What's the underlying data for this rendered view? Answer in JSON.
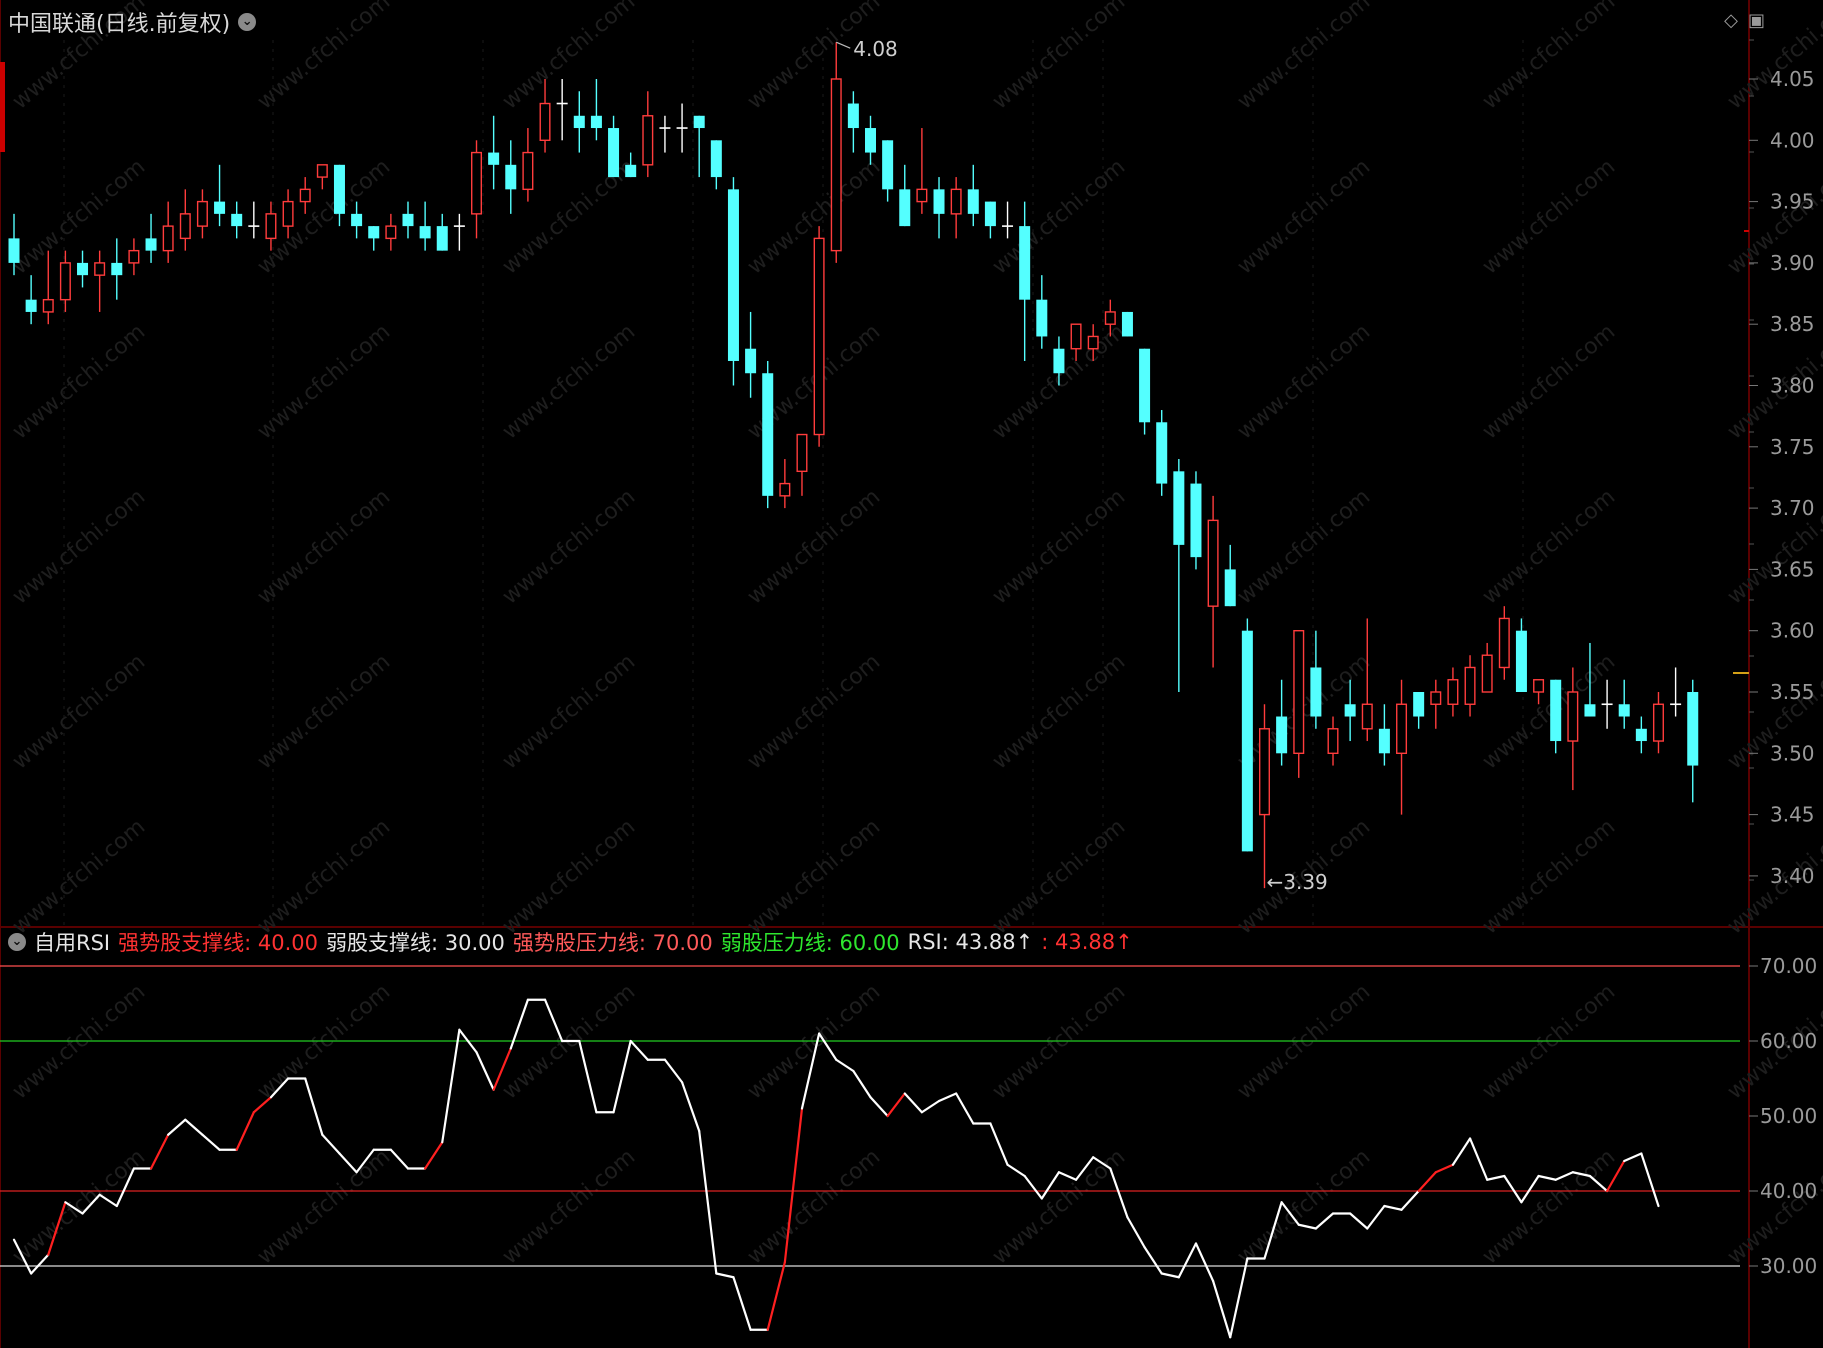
{
  "header": {
    "title": "中国联通(日线.前复权)",
    "menu_icon": "chevron-down-icon",
    "window_icons": [
      "diamond-icon",
      "restore-icon"
    ]
  },
  "price_panel": {
    "y_axis_labels": [
      "4.05",
      "4.00",
      "3.95",
      "3.90",
      "3.85",
      "3.80",
      "3.75",
      "3.70",
      "3.65",
      "3.60",
      "3.55",
      "3.50",
      "3.45",
      "3.40"
    ],
    "high_annotation": "4.08",
    "low_annotation": "3.39",
    "colors": {
      "up": "#ff3c3c",
      "down": "#54ffff",
      "doji": "#ffffff"
    }
  },
  "rsi_panel": {
    "indicator_name": "自用RSI",
    "legend": [
      {
        "text": "强势股支撑线: 40.00",
        "color": "#ff3232"
      },
      {
        "text": "弱股支撑线: 30.00",
        "color": "#e6e6e6"
      },
      {
        "text": "强势股压力线: 70.00",
        "color": "#ff5a5a"
      },
      {
        "text": "弱股压力线: 60.00",
        "color": "#2ee62e"
      },
      {
        "text": "RSI: 43.88↑",
        "color": "#e6e6e6"
      },
      {
        "text": ": 43.88↑",
        "color": "#ff3232"
      }
    ],
    "y_axis_labels": [
      "70.00",
      "60.00",
      "50.00",
      "40.00",
      "30.00"
    ],
    "level_colors": {
      "70": "#ff5050",
      "60": "#22cc22",
      "40": "#dd2222",
      "30": "#dddddd"
    }
  },
  "watermark": "www.cfchi.com",
  "chart_data": [
    {
      "type": "candlestick",
      "title": "中国联通(日线.前复权)",
      "ylim": [
        3.37,
        4.1
      ],
      "candles": [
        {
          "o": 3.92,
          "h": 3.94,
          "l": 3.89,
          "c": 3.9
        },
        {
          "o": 3.87,
          "h": 3.89,
          "l": 3.85,
          "c": 3.86
        },
        {
          "o": 3.86,
          "h": 3.91,
          "l": 3.85,
          "c": 3.87
        },
        {
          "o": 3.87,
          "h": 3.91,
          "l": 3.86,
          "c": 3.9
        },
        {
          "o": 3.9,
          "h": 3.91,
          "l": 3.88,
          "c": 3.89
        },
        {
          "o": 3.89,
          "h": 3.91,
          "l": 3.86,
          "c": 3.9
        },
        {
          "o": 3.9,
          "h": 3.92,
          "l": 3.87,
          "c": 3.89
        },
        {
          "o": 3.9,
          "h": 3.92,
          "l": 3.89,
          "c": 3.91
        },
        {
          "o": 3.92,
          "h": 3.94,
          "l": 3.9,
          "c": 3.91
        },
        {
          "o": 3.91,
          "h": 3.95,
          "l": 3.9,
          "c": 3.93
        },
        {
          "o": 3.92,
          "h": 3.96,
          "l": 3.91,
          "c": 3.94
        },
        {
          "o": 3.93,
          "h": 3.96,
          "l": 3.92,
          "c": 3.95
        },
        {
          "o": 3.95,
          "h": 3.98,
          "l": 3.93,
          "c": 3.94
        },
        {
          "o": 3.94,
          "h": 3.95,
          "l": 3.92,
          "c": 3.93
        },
        {
          "o": 3.93,
          "h": 3.95,
          "l": 3.92,
          "c": 3.93
        },
        {
          "o": 3.92,
          "h": 3.95,
          "l": 3.91,
          "c": 3.94
        },
        {
          "o": 3.93,
          "h": 3.96,
          "l": 3.92,
          "c": 3.95
        },
        {
          "o": 3.95,
          "h": 3.97,
          "l": 3.94,
          "c": 3.96
        },
        {
          "o": 3.97,
          "h": 3.98,
          "l": 3.96,
          "c": 3.98
        },
        {
          "o": 3.98,
          "h": 3.98,
          "l": 3.93,
          "c": 3.94
        },
        {
          "o": 3.94,
          "h": 3.95,
          "l": 3.92,
          "c": 3.93
        },
        {
          "o": 3.93,
          "h": 3.93,
          "l": 3.91,
          "c": 3.92
        },
        {
          "o": 3.92,
          "h": 3.94,
          "l": 3.91,
          "c": 3.93
        },
        {
          "o": 3.94,
          "h": 3.95,
          "l": 3.92,
          "c": 3.93
        },
        {
          "o": 3.93,
          "h": 3.95,
          "l": 3.91,
          "c": 3.92
        },
        {
          "o": 3.93,
          "h": 3.94,
          "l": 3.91,
          "c": 3.91
        },
        {
          "o": 3.93,
          "h": 3.94,
          "l": 3.91,
          "c": 3.93
        },
        {
          "o": 3.94,
          "h": 4.0,
          "l": 3.92,
          "c": 3.99
        },
        {
          "o": 3.99,
          "h": 4.02,
          "l": 3.96,
          "c": 3.98
        },
        {
          "o": 3.98,
          "h": 4.0,
          "l": 3.94,
          "c": 3.96
        },
        {
          "o": 3.96,
          "h": 4.01,
          "l": 3.95,
          "c": 3.99
        },
        {
          "o": 4.0,
          "h": 4.05,
          "l": 3.99,
          "c": 4.03
        },
        {
          "o": 4.03,
          "h": 4.05,
          "l": 4.0,
          "c": 4.03
        },
        {
          "o": 4.02,
          "h": 4.04,
          "l": 3.99,
          "c": 4.01
        },
        {
          "o": 4.02,
          "h": 4.05,
          "l": 4.0,
          "c": 4.01
        },
        {
          "o": 4.01,
          "h": 4.02,
          "l": 3.97,
          "c": 3.97
        },
        {
          "o": 3.98,
          "h": 3.99,
          "l": 3.97,
          "c": 3.97
        },
        {
          "o": 3.98,
          "h": 4.04,
          "l": 3.97,
          "c": 4.02
        },
        {
          "o": 4.01,
          "h": 4.02,
          "l": 3.99,
          "c": 4.01
        },
        {
          "o": 4.01,
          "h": 4.03,
          "l": 3.99,
          "c": 4.01
        },
        {
          "o": 4.02,
          "h": 4.02,
          "l": 3.97,
          "c": 4.01
        },
        {
          "o": 4.0,
          "h": 4.0,
          "l": 3.96,
          "c": 3.97
        },
        {
          "o": 3.96,
          "h": 3.97,
          "l": 3.8,
          "c": 3.82
        },
        {
          "o": 3.83,
          "h": 3.86,
          "l": 3.79,
          "c": 3.81
        },
        {
          "o": 3.81,
          "h": 3.82,
          "l": 3.7,
          "c": 3.71
        },
        {
          "o": 3.71,
          "h": 3.74,
          "l": 3.7,
          "c": 3.72
        },
        {
          "o": 3.73,
          "h": 3.76,
          "l": 3.71,
          "c": 3.76
        },
        {
          "o": 3.76,
          "h": 3.93,
          "l": 3.75,
          "c": 3.92
        },
        {
          "o": 3.91,
          "h": 4.08,
          "l": 3.9,
          "c": 4.05
        },
        {
          "o": 4.03,
          "h": 4.04,
          "l": 3.99,
          "c": 4.01
        },
        {
          "o": 4.01,
          "h": 4.02,
          "l": 3.98,
          "c": 3.99
        },
        {
          "o": 4.0,
          "h": 4.0,
          "l": 3.95,
          "c": 3.96
        },
        {
          "o": 3.96,
          "h": 3.98,
          "l": 3.93,
          "c": 3.93
        },
        {
          "o": 3.95,
          "h": 4.01,
          "l": 3.94,
          "c": 3.96
        },
        {
          "o": 3.96,
          "h": 3.97,
          "l": 3.92,
          "c": 3.94
        },
        {
          "o": 3.94,
          "h": 3.97,
          "l": 3.92,
          "c": 3.96
        },
        {
          "o": 3.96,
          "h": 3.98,
          "l": 3.93,
          "c": 3.94
        },
        {
          "o": 3.95,
          "h": 3.95,
          "l": 3.92,
          "c": 3.93
        },
        {
          "o": 3.93,
          "h": 3.95,
          "l": 3.92,
          "c": 3.93
        },
        {
          "o": 3.93,
          "h": 3.95,
          "l": 3.82,
          "c": 3.87
        },
        {
          "o": 3.87,
          "h": 3.89,
          "l": 3.83,
          "c": 3.84
        },
        {
          "o": 3.83,
          "h": 3.84,
          "l": 3.8,
          "c": 3.81
        },
        {
          "o": 3.83,
          "h": 3.85,
          "l": 3.82,
          "c": 3.85
        },
        {
          "o": 3.83,
          "h": 3.85,
          "l": 3.82,
          "c": 3.84
        },
        {
          "o": 3.85,
          "h": 3.87,
          "l": 3.84,
          "c": 3.86
        },
        {
          "o": 3.86,
          "h": 3.86,
          "l": 3.84,
          "c": 3.84
        },
        {
          "o": 3.83,
          "h": 3.83,
          "l": 3.76,
          "c": 3.77
        },
        {
          "o": 3.77,
          "h": 3.78,
          "l": 3.71,
          "c": 3.72
        },
        {
          "o": 3.73,
          "h": 3.74,
          "l": 3.55,
          "c": 3.67
        },
        {
          "o": 3.72,
          "h": 3.73,
          "l": 3.65,
          "c": 3.66
        },
        {
          "o": 3.62,
          "h": 3.71,
          "l": 3.57,
          "c": 3.69
        },
        {
          "o": 3.65,
          "h": 3.67,
          "l": 3.62,
          "c": 3.62
        },
        {
          "o": 3.6,
          "h": 3.61,
          "l": 3.42,
          "c": 3.42
        },
        {
          "o": 3.45,
          "h": 3.54,
          "l": 3.39,
          "c": 3.52
        },
        {
          "o": 3.53,
          "h": 3.56,
          "l": 3.49,
          "c": 3.5
        },
        {
          "o": 3.5,
          "h": 3.6,
          "l": 3.48,
          "c": 3.6
        },
        {
          "o": 3.57,
          "h": 3.6,
          "l": 3.52,
          "c": 3.53
        },
        {
          "o": 3.5,
          "h": 3.53,
          "l": 3.49,
          "c": 3.52
        },
        {
          "o": 3.54,
          "h": 3.56,
          "l": 3.51,
          "c": 3.53
        },
        {
          "o": 3.52,
          "h": 3.61,
          "l": 3.51,
          "c": 3.54
        },
        {
          "o": 3.52,
          "h": 3.54,
          "l": 3.49,
          "c": 3.5
        },
        {
          "o": 3.5,
          "h": 3.56,
          "l": 3.45,
          "c": 3.54
        },
        {
          "o": 3.55,
          "h": 3.55,
          "l": 3.52,
          "c": 3.53
        },
        {
          "o": 3.54,
          "h": 3.56,
          "l": 3.52,
          "c": 3.55
        },
        {
          "o": 3.54,
          "h": 3.57,
          "l": 3.53,
          "c": 3.56
        },
        {
          "o": 3.54,
          "h": 3.58,
          "l": 3.53,
          "c": 3.57
        },
        {
          "o": 3.55,
          "h": 3.59,
          "l": 3.55,
          "c": 3.58
        },
        {
          "o": 3.57,
          "h": 3.62,
          "l": 3.56,
          "c": 3.61
        },
        {
          "o": 3.6,
          "h": 3.61,
          "l": 3.55,
          "c": 3.55
        },
        {
          "o": 3.55,
          "h": 3.56,
          "l": 3.54,
          "c": 3.56
        },
        {
          "o": 3.56,
          "h": 3.56,
          "l": 3.5,
          "c": 3.51
        },
        {
          "o": 3.51,
          "h": 3.57,
          "l": 3.47,
          "c": 3.55
        },
        {
          "o": 3.54,
          "h": 3.59,
          "l": 3.53,
          "c": 3.53
        },
        {
          "o": 3.54,
          "h": 3.56,
          "l": 3.52,
          "c": 3.54
        },
        {
          "o": 3.54,
          "h": 3.56,
          "l": 3.52,
          "c": 3.53
        },
        {
          "o": 3.52,
          "h": 3.53,
          "l": 3.5,
          "c": 3.51
        },
        {
          "o": 3.51,
          "h": 3.55,
          "l": 3.5,
          "c": 3.54
        },
        {
          "o": 3.54,
          "h": 3.57,
          "l": 3.53,
          "c": 3.54
        },
        {
          "o": 3.55,
          "h": 3.56,
          "l": 3.46,
          "c": 3.49
        }
      ]
    },
    {
      "type": "line",
      "title": "自用RSI",
      "ylim": [
        19,
        73
      ],
      "levels": [
        70,
        60,
        40,
        30
      ],
      "series": [
        {
          "name": "RSI",
          "values": [
            33.5,
            29,
            31.5,
            38.5,
            37,
            39.5,
            38,
            43,
            43,
            47.5,
            49.5,
            47.5,
            45.5,
            45.5,
            50.5,
            52.5,
            55,
            55,
            47.5,
            45,
            42.5,
            45.5,
            45.5,
            43,
            43,
            46.5,
            61.5,
            58.5,
            53.5,
            59,
            65.5,
            65.5,
            60,
            60,
            50.5,
            50.5,
            60,
            57.5,
            57.5,
            54.5,
            48,
            29,
            28.5,
            21.5,
            21.5,
            30.5,
            51,
            61,
            57.5,
            56,
            52.5,
            50,
            53,
            50.5,
            52,
            53,
            49,
            49,
            43.5,
            42,
            39,
            42.5,
            41.5,
            44.5,
            43,
            36.5,
            32.5,
            29,
            28.5,
            33,
            28,
            20.5,
            31,
            31,
            38.5,
            35.5,
            35,
            37,
            37,
            35,
            38,
            37.5,
            40,
            42.5,
            43.5,
            47,
            41.5,
            42,
            38.5,
            42,
            41.5,
            42.5,
            42,
            40,
            44,
            45,
            38
          ],
          "highlight": [
            false,
            false,
            true,
            true,
            false,
            false,
            false,
            false,
            true,
            true,
            false,
            false,
            false,
            true,
            true,
            true,
            false,
            false,
            false,
            false,
            false,
            false,
            false,
            false,
            true,
            true,
            false,
            false,
            true,
            true,
            false,
            false,
            false,
            false,
            false,
            false,
            false,
            false,
            false,
            false,
            false,
            false,
            false,
            false,
            true,
            true,
            true,
            false,
            false,
            false,
            false,
            true,
            true,
            false,
            false,
            false,
            false,
            false,
            false,
            false,
            false,
            false,
            false,
            false,
            false,
            false,
            false,
            false,
            false,
            false,
            false,
            false,
            false,
            false,
            false,
            false,
            false,
            false,
            false,
            false,
            false,
            false,
            true,
            true,
            true,
            false,
            false,
            false,
            false,
            false,
            false,
            false,
            false,
            true,
            true,
            false,
            false
          ]
        }
      ]
    }
  ]
}
